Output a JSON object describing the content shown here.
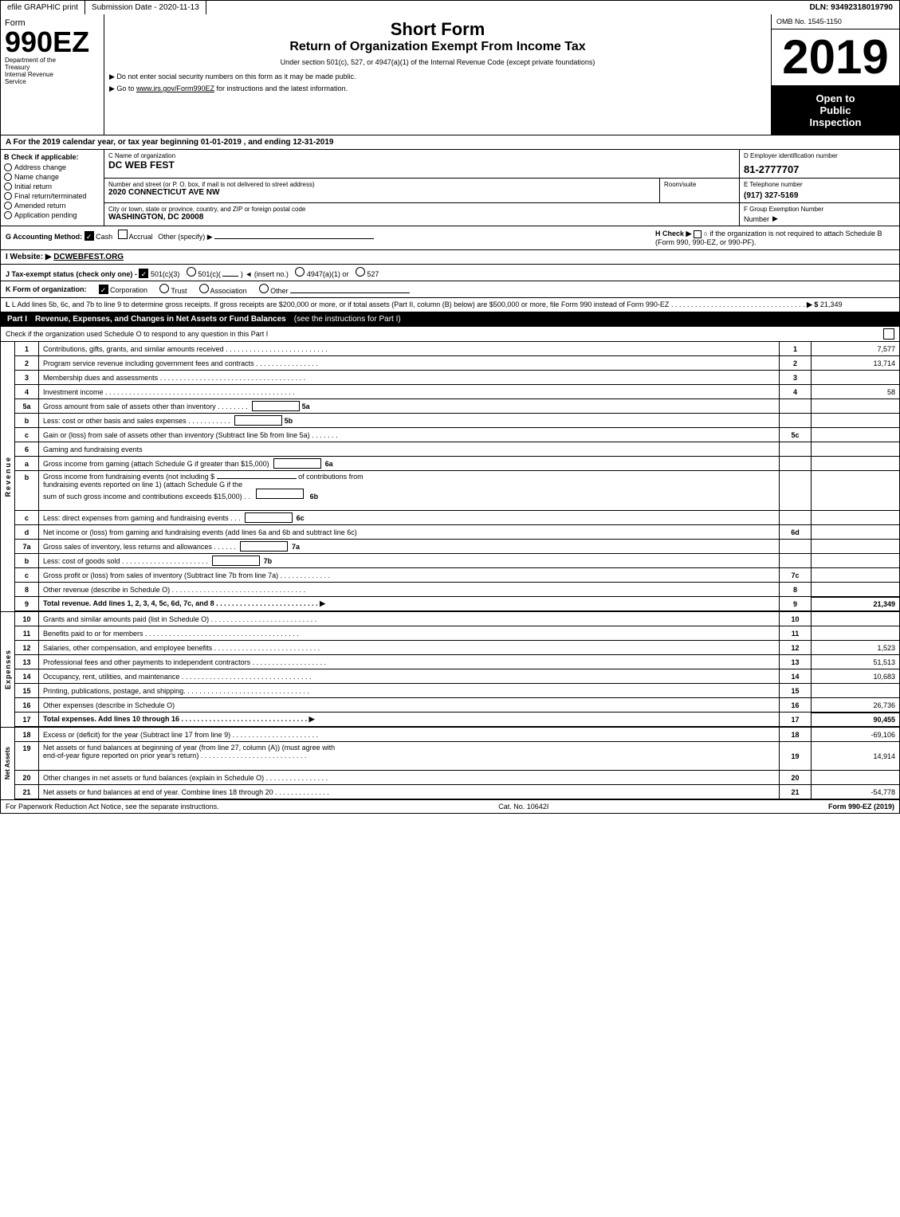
{
  "header": {
    "efile": "efile GRAPHIC print",
    "submission": "Submission Date - 2020-11-13",
    "dln": "DLN: 93492318019790"
  },
  "form": {
    "number": "990EZ",
    "dept_line1": "Department of the",
    "dept_line2": "Treasury",
    "dept_line3": "Internal Revenue",
    "dept_line4": "Service",
    "short_form": "Short Form",
    "return_title": "Return of Organization Exempt From Income Tax",
    "subtitle": "Under section 501(c), 527, or 4947(a)(1) of the Internal Revenue Code (except private foundations)",
    "instruction1": "▶ Do not enter social security numbers on this form as it may be made public.",
    "instruction2": "▶ Go to www.irs.gov/Form990EZ for instructions and the latest information.",
    "instruction2_url": "www.irs.gov/Form990EZ",
    "year": "2019",
    "omb": "OMB No. 1545-1150",
    "open_to_public": "Open to",
    "public": "Public",
    "inspection": "Inspection"
  },
  "section_a": {
    "text": "A  For the 2019 calendar year, or tax year beginning 01-01-2019 , and ending 12-31-2019"
  },
  "section_b": {
    "label": "B  Check if applicable:",
    "items": [
      {
        "id": "address_change",
        "label": "Address change",
        "checked": false
      },
      {
        "id": "name_change",
        "label": "Name change",
        "checked": false
      },
      {
        "id": "initial_return",
        "label": "Initial return",
        "checked": false
      },
      {
        "id": "final_return",
        "label": "Final return/terminated",
        "checked": false
      },
      {
        "id": "amended_return",
        "label": "Amended return",
        "checked": false
      },
      {
        "id": "application_pending",
        "label": "Application pending",
        "checked": false
      }
    ]
  },
  "org": {
    "c_label": "C Name of organization",
    "name": "DC WEB FEST",
    "d_label": "D Employer identification number",
    "ein": "81-2777707",
    "street_label": "Number and street (or P. O. box, if mail is not delivered to street address)",
    "street": "2020 CONNECTICUT AVE NW",
    "room_label": "Room/suite",
    "room": "",
    "e_label": "E Telephone number",
    "phone": "(917) 327-5169",
    "city_label": "City or town, state or province, country, and ZIP or foreign postal code",
    "city": "WASHINGTON, DC  20008",
    "f_label": "F Group Exemption Number",
    "group_num": ""
  },
  "accounting": {
    "g_label": "G Accounting Method:",
    "cash_checked": true,
    "accrual_checked": false,
    "other_label": "Other (specify) ▶",
    "h_label": "H  Check ▶",
    "h_text": "○ if the organization is not required to attach Schedule B (Form 990, 990-EZ, or 990-PF)."
  },
  "website": {
    "label": "I Website: ▶",
    "url": "DCWEBFEST.ORG"
  },
  "tax_status": {
    "label": "J Tax-exempt status (check only one) -",
    "options": [
      "✓ 501(c)(3)",
      "○ 501(c)(",
      ") ◄ (insert no.)",
      "○ 4947(a)(1) or",
      "○ 527"
    ]
  },
  "form_org": {
    "label": "K Form of organization:",
    "options": [
      "✓ Corporation",
      "○ Trust",
      "○ Association",
      "○ Other"
    ]
  },
  "lines_l": {
    "text": "L Add lines 5b, 6c, and 7b to line 9 to determine gross receipts. If gross receipts are $200,000 or more, or if total assets (Part II, column (B) below) are $500,000 or more, file Form 990 instead of Form 990-EZ",
    "dots": ". . . . . . . . . . . . . . . . . . . . . . . . . . . . . . . . . .",
    "arrow": "▶ $",
    "value": "21,349"
  },
  "part1": {
    "label": "Part I",
    "title": "Revenue, Expenses, and Changes in Net Assets or Fund Balances",
    "see_instructions": "(see the instructions for Part I)",
    "check_text": "Check if the organization used Schedule O to respond to any question in this Part I",
    "rows": [
      {
        "num": "1",
        "desc": "Contributions, gifts, grants, and similar amounts received",
        "dots": true,
        "line": "1",
        "value": "7,577"
      },
      {
        "num": "2",
        "desc": "Program service revenue including government fees and contracts",
        "dots": true,
        "line": "2",
        "value": "13,714"
      },
      {
        "num": "3",
        "desc": "Membership dues and assessments",
        "dots": true,
        "line": "3",
        "value": ""
      },
      {
        "num": "4",
        "desc": "Investment income",
        "dots": true,
        "line": "4",
        "value": "58"
      },
      {
        "num": "5a",
        "desc": "Gross amount from sale of assets other than inventory",
        "dots": false,
        "line": "5a",
        "value": ""
      },
      {
        "num": "5b",
        "desc": "Less: cost or other basis and sales expenses",
        "dots": false,
        "line": "5b",
        "value": ""
      },
      {
        "num": "5c",
        "desc": "Gain or (loss) from sale of assets other than inventory (Subtract line 5b from line 5a)",
        "dots": true,
        "line": "5c",
        "value": ""
      },
      {
        "num": "6",
        "desc": "Gaming and fundraising events",
        "dots": false,
        "line": "",
        "value": ""
      },
      {
        "num": "6a",
        "desc": "Gross income from gaming (attach Schedule G if greater than $15,000)",
        "dots": false,
        "line": "6a",
        "value": ""
      },
      {
        "num": "6b",
        "desc": "Gross income from fundraising events (not including $ ________________ of contributions from fundraising events reported on line 1) (attach Schedule G if the sum of such gross income and contributions exceeds $15,000)",
        "dots": false,
        "line": "6b",
        "value": ""
      },
      {
        "num": "6c",
        "desc": "Less: direct expenses from gaming and fundraising events",
        "dots": false,
        "line": "6c",
        "value": ""
      },
      {
        "num": "6d",
        "desc": "Net income or (loss) from gaming and fundraising events (add lines 6a and 6b and subtract line 6c)",
        "dots": false,
        "line": "6d",
        "value": ""
      },
      {
        "num": "7a",
        "desc": "Gross sales of inventory, less returns and allowances",
        "dots": true,
        "line": "7a",
        "value": ""
      },
      {
        "num": "7b",
        "desc": "Less: cost of goods sold",
        "dots": true,
        "line": "7b",
        "value": ""
      },
      {
        "num": "7c",
        "desc": "Gross profit or (loss) from sales of inventory (Subtract line 7b from line 7a)",
        "dots": true,
        "line": "7c",
        "value": ""
      },
      {
        "num": "8",
        "desc": "Other revenue (describe in Schedule O)",
        "dots": true,
        "line": "8",
        "value": ""
      },
      {
        "num": "9",
        "desc": "Total revenue. Add lines 1, 2, 3, 4, 5c, 6d, 7c, and 8",
        "dots": true,
        "line": "9",
        "value": "21,349",
        "total": true,
        "arrow": true
      }
    ],
    "expense_rows": [
      {
        "num": "10",
        "desc": "Grants and similar amounts paid (list in Schedule O)",
        "dots": true,
        "line": "10",
        "value": ""
      },
      {
        "num": "11",
        "desc": "Benefits paid to or for members",
        "dots": true,
        "line": "11",
        "value": ""
      },
      {
        "num": "12",
        "desc": "Salaries, other compensation, and employee benefits",
        "dots": true,
        "line": "12",
        "value": "1,523"
      },
      {
        "num": "13",
        "desc": "Professional fees and other payments to independent contractors",
        "dots": true,
        "line": "13",
        "value": "51,513"
      },
      {
        "num": "14",
        "desc": "Occupancy, rent, utilities, and maintenance",
        "dots": true,
        "line": "14",
        "value": "10,683"
      },
      {
        "num": "15",
        "desc": "Printing, publications, postage, and shipping",
        "dots": true,
        "line": "15",
        "value": ""
      },
      {
        "num": "16",
        "desc": "Other expenses (describe in Schedule O)",
        "dots": false,
        "line": "16",
        "value": "26,736"
      },
      {
        "num": "17",
        "desc": "Total expenses. Add lines 10 through 16",
        "dots": true,
        "line": "17",
        "value": "90,455",
        "total": true,
        "arrow": true
      }
    ],
    "asset_rows": [
      {
        "num": "18",
        "desc": "Excess or (deficit) for the year (Subtract line 17 from line 9)",
        "dots": true,
        "line": "18",
        "value": "-69,106"
      },
      {
        "num": "19",
        "desc": "Net assets or fund balances at beginning of year (from line 27, column (A)) (must agree with end-of-year figure reported on prior year's return)",
        "dots": true,
        "line": "19",
        "value": "14,914"
      },
      {
        "num": "20",
        "desc": "Other changes in net assets or fund balances (explain in Schedule O)",
        "dots": true,
        "line": "20",
        "value": ""
      },
      {
        "num": "21",
        "desc": "Net assets or fund balances at end of year. Combine lines 18 through 20",
        "dots": true,
        "line": "21",
        "value": "-54,778"
      }
    ]
  },
  "footer": {
    "paperwork_text": "For Paperwork Reduction Act Notice, see the separate instructions.",
    "cat_no": "Cat. No. 10642I",
    "form_label": "Form 990-EZ (2019)"
  }
}
